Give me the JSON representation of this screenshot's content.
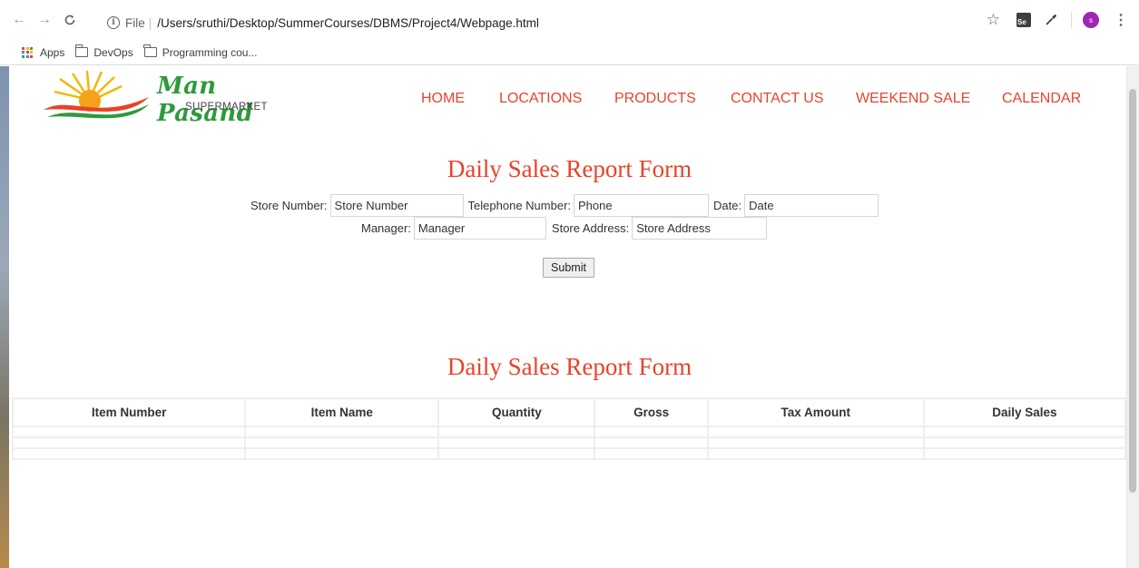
{
  "browser": {
    "url_scheme": "File",
    "url_path": "/Users/sruthi/Desktop/SummerCourses/DBMS/Project4/Webpage.html",
    "profile_initial": "s",
    "bookmarks": [
      {
        "label": "Apps",
        "icon": "apps-grid-icon"
      },
      {
        "label": "DevOps",
        "icon": "folder-icon"
      },
      {
        "label": "Programming cou...",
        "icon": "folder-icon"
      }
    ]
  },
  "logo": {
    "name": "Man Pasand",
    "subtitle": "SUPERMARKET"
  },
  "menu": [
    "HOME",
    "LOCATIONS",
    "PRODUCTS",
    "CONTACT US",
    "WEEKEND SALE",
    "CALENDAR"
  ],
  "form": {
    "title": "Daily Sales Report Form",
    "store_number_label": "Store Number:",
    "store_number_placeholder": "Store Number",
    "telephone_label": "Telephone Number:",
    "telephone_placeholder": "Phone",
    "date_label": "Date:",
    "date_placeholder": "Date",
    "manager_label": "Manager:",
    "manager_placeholder": "Manager",
    "address_label": "Store Address:",
    "address_placeholder": "Store Address",
    "submit_label": "Submit"
  },
  "table": {
    "title": "Daily Sales Report Form",
    "headers": [
      "Item Number",
      "Item Name",
      "Quantity",
      "Gross",
      "Tax Amount",
      "Daily Sales"
    ],
    "empty_rows": 3
  },
  "colors": {
    "accent": "#e8432a",
    "logo_green": "#2e9a3a"
  }
}
